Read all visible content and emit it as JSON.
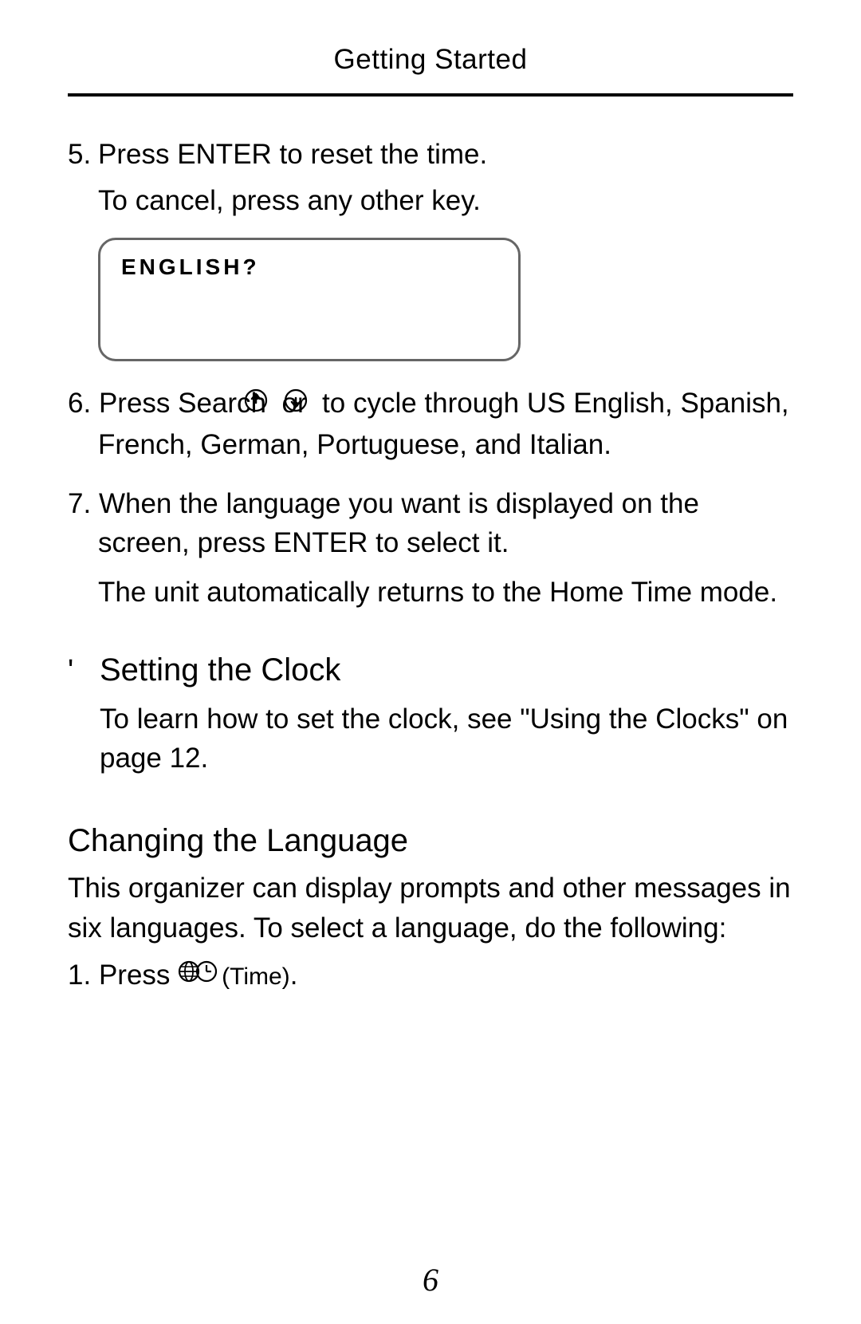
{
  "header": "Getting Started",
  "step5": {
    "num": "5.",
    "line1": "Press ENTER to reset the time.",
    "line2": "To cancel, press any other key."
  },
  "screenbox": "ENGLISH?",
  "step6": {
    "num": "6.",
    "pre": "Press Search ",
    "mid": " or ",
    "post": " to cycle through US English, Spanish, French, German, Portu­guese, and Italian."
  },
  "step7": {
    "num": "7.",
    "text": "When the language you want is displayed on the screen, press ENTER to select it.",
    "note": "The unit automatically returns to the Home Time mode."
  },
  "setting_clock": {
    "bullet": "'",
    "heading": "Setting the Clock",
    "body": "To learn how to set the clock, see \"Using the Clocks\" on page 12."
  },
  "changing_lang": {
    "heading": "Changing the Language",
    "body": "This organizer can display prompts and other mes­sages in six languages. To select a language, do the following:",
    "step1_num": "1.",
    "step1_pre": "Press ",
    "step1_time": "(Time)",
    "step1_post": "."
  },
  "page_number": "6"
}
